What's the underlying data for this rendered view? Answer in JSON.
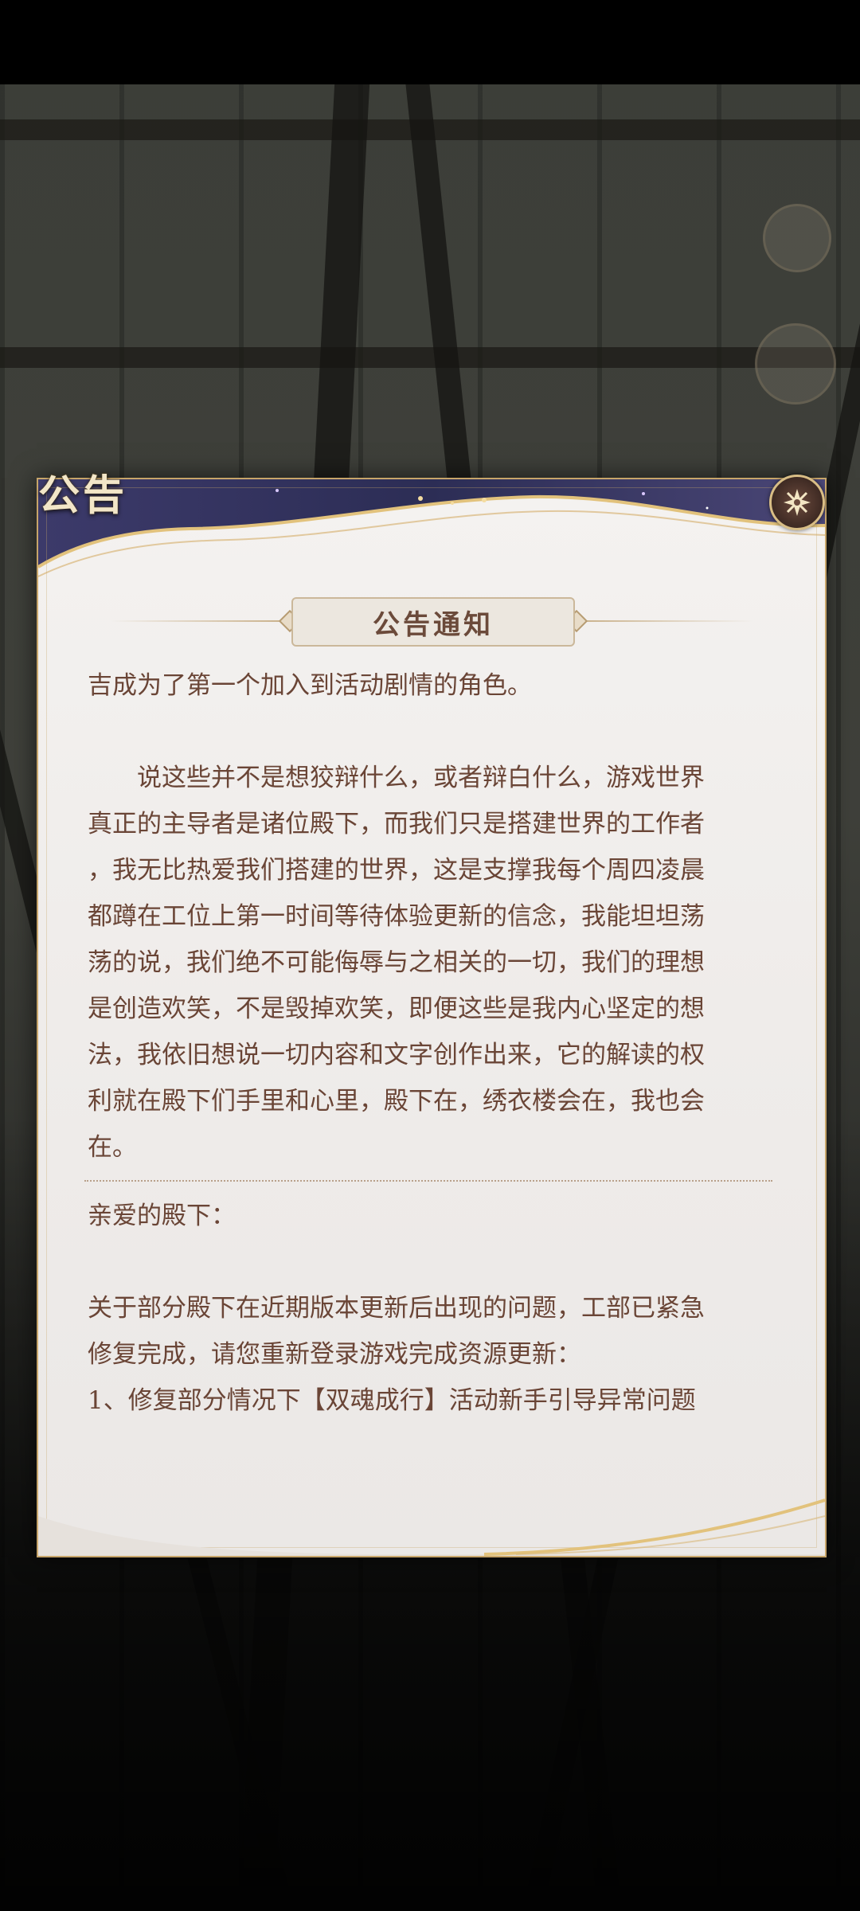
{
  "tab_label": "公告",
  "notice_title": "公告通知",
  "close_icon": "close-icon",
  "paragraphs": {
    "intro": "吉成为了第一个加入到活动剧情的角色。",
    "body_lines": [
      "　　说这些并不是想狡辩什么，或者辩白什么，游戏世界",
      "真正的主导者是诸位殿下，而我们只是搭建世界的工作者",
      "，我无比热爱我们搭建的世界，这是支撑我每个周四凌晨",
      "都蹲在工位上第一时间等待体验更新的信念，我能坦坦荡",
      "荡的说，我们绝不可能侮辱与之相关的一切，我们的理想",
      "是创造欢笑，不是毁掉欢笑，即便这些是我内心坚定的想",
      "法，我依旧想说一切内容和文字创作出来，它的解读的权",
      "利就在殿下们手里和心里，殿下在，绣衣楼会在，我也会",
      "在。"
    ],
    "greeting": "亲爱的殿下：",
    "update_lines": [
      "关于部分殿下在近期版本更新后出现的问题，工部已紧急",
      "修复完成，请您重新登录游戏完成资源更新："
    ],
    "fix_item": "1、修复部分情况下【双魂成行】活动新手引导异常问题"
  },
  "colors": {
    "text": "#6a4536",
    "header_navy": "#2f2f5a",
    "gold": "#c7a56a"
  }
}
